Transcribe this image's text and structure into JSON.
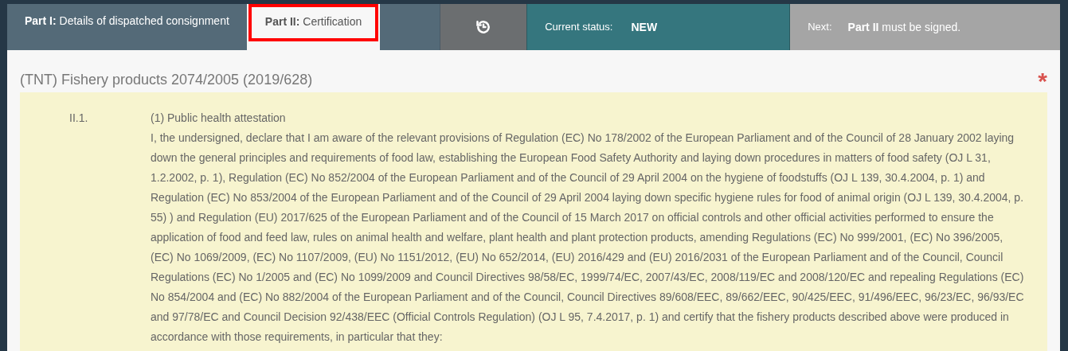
{
  "tabs": [
    {
      "prefix": "Part I:",
      "label": "Details of dispatched consignment",
      "selected": false
    },
    {
      "prefix": "Part II:",
      "label": "Certification",
      "selected": true
    }
  ],
  "status": {
    "label": "Current status:",
    "value": "NEW"
  },
  "next": {
    "label": "Next:",
    "text": "**Part II** must be signed."
  },
  "title": "(TNT) Fishery products 2074/2005 (2019/628)",
  "required_mark": "*",
  "section": {
    "number": "II.1.",
    "heading": "(1) Public health attestation",
    "body": "I, the undersigned, declare that I am aware of the relevant provisions of Regulation (EC) No 178/2002 of the European Parliament and of the Council of 28 January 2002 laying down the general principles and requirements of food law, establishing the European Food Safety Authority and laying down procedures in matters of food safety (OJ L 31, 1.2.2002, p. 1), Regulation (EC) No 852/2004 of the European Parliament and of the Council of 29 April 2004 on the hygiene of foodstuffs (OJ L 139, 30.4.2004, p. 1) and Regulation (EC) No 853/2004 of the European Parliament and of the Council of 29 April 2004 laying down specific hygiene rules for food of animal origin (OJ L 139, 30.4.2004, p. 55) ) and Regulation (EU) 2017/625 of the European Parliament and of the Council of 15 March 2017 on official controls and other official activities performed to ensure the application of food and feed law, rules on animal health and welfare, plant health and plant protection products, amending Regulations (EC) No 999/2001, (EC) No 396/2005, (EC) No 1069/2009, (EC) No 1107/2009, (EU) No 1151/2012, (EU) No 652/2014, (EU) 2016/429 and (EU) 2016/2031 of the European Parliament and of the Council, Council Regulations (EC) No 1/2005 and (EC) No 1099/2009 and Council Directives 98/58/EC, 1999/74/EC, 2007/43/EC, 2008/119/EC and 2008/120/EC and repealing Regulations (EC) No 854/2004 and (EC) No 882/2004 of the European Parliament and of the Council, Council Directives 89/608/EEC, 89/662/EEC, 90/425/EEC, 91/496/EEC, 96/23/EC, 96/93/EC and 97/78/EC and Council Decision 92/438/EEC (Official Controls Regulation) (OJ L 95, 7.4.2017, p. 1) and certify that the fishery products described above were produced in accordance with those requirements, in particular that they:"
  }
}
